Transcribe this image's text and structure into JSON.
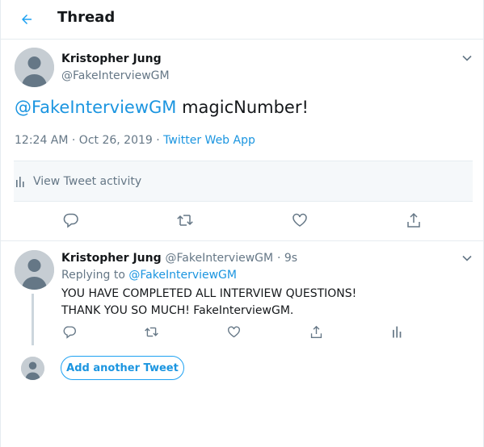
{
  "header": {
    "title": "Thread",
    "back_icon": "arrow-left-icon"
  },
  "colors": {
    "accent": "#1da1f2",
    "link": "#1b95e0",
    "muted": "#657786",
    "text": "#14171a",
    "border": "#e6ecf0"
  },
  "main_tweet": {
    "author_name": "Kristopher Jung",
    "author_handle": "@FakeInterviewGM",
    "mention": "@FakeInterviewGM",
    "text": " magicNumber!",
    "timestamp": "12:24 AM · Oct 26, 2019",
    "separator": " · ",
    "source": "Twitter Web App",
    "activity_label": "View Tweet activity",
    "actions": [
      "reply-icon",
      "retweet-icon",
      "like-icon",
      "share-icon"
    ]
  },
  "reply_tweet": {
    "author_name": "Kristopher Jung",
    "author_handle": "@FakeInterviewGM",
    "time": "· 9s",
    "replying_prefix": "Replying to ",
    "replying_handle": "@FakeInterviewGM",
    "line1": "YOU HAVE COMPLETED ALL INTERVIEW QUESTIONS!",
    "line2": "THANK YOU SO MUCH! FakeInterviewGM.",
    "actions": [
      "reply-icon",
      "retweet-icon",
      "like-icon",
      "share-icon",
      "analytics-icon"
    ]
  },
  "compose": {
    "add_label": "Add another Tweet"
  }
}
